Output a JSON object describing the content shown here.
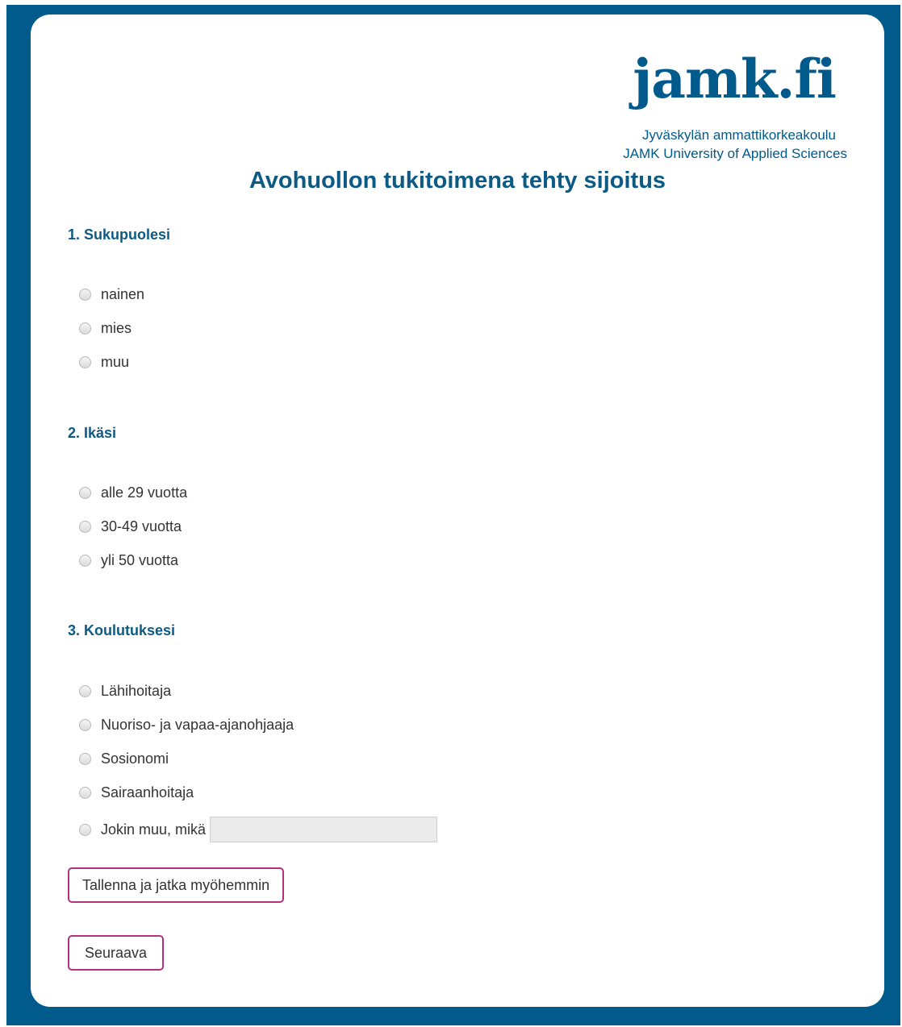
{
  "logo": {
    "mark": "jamk.fi",
    "line1": "Jyväskylän ammattikorkeakoulu",
    "line2": "JAMK University of Applied Sciences"
  },
  "title": "Avohuollon tukitoimena tehty sijoitus",
  "questions": [
    {
      "title": "1. Sukupuolesi",
      "options": [
        "nainen",
        "mies",
        "muu"
      ]
    },
    {
      "title": "2. Ikäsi",
      "options": [
        "alle 29 vuotta",
        "30-49 vuotta",
        "yli 50 vuotta"
      ]
    },
    {
      "title": "3. Koulutuksesi",
      "options": [
        "Lähihoitaja",
        "Nuoriso- ja vapaa-ajanohjaaja",
        "Sosionomi",
        "Sairaanhoitaja",
        "Jokin muu, mikä"
      ],
      "other_value": ""
    }
  ],
  "buttons": {
    "save_later": "Tallenna ja jatka myöhemmin",
    "next": "Seuraava"
  },
  "colors": {
    "frame": "#005a8c",
    "heading": "#0d5a85",
    "button_border": "#b5317b"
  }
}
